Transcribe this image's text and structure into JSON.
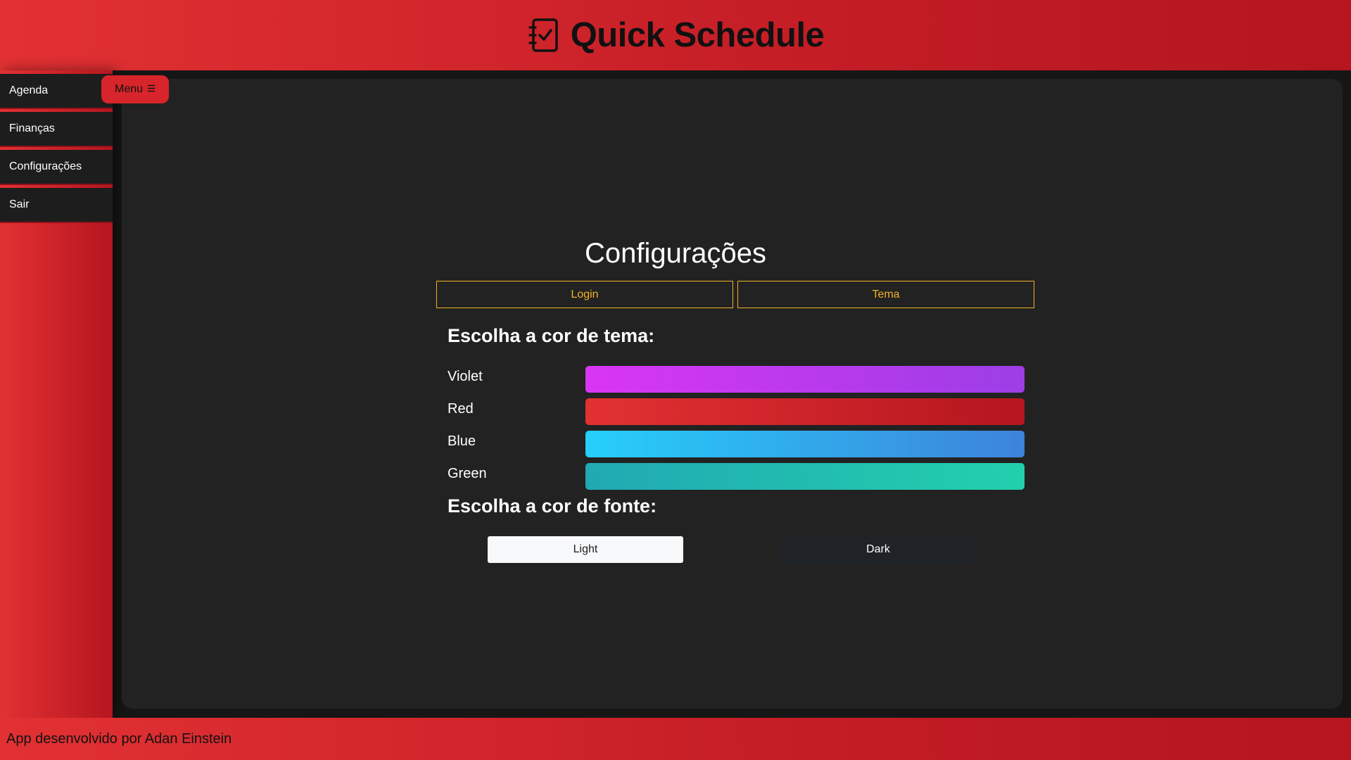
{
  "header": {
    "title": "Quick Schedule",
    "logo_icon": "checklist-notebook-icon"
  },
  "sidebar": {
    "items": [
      {
        "label": "Agenda"
      },
      {
        "label": "Finanças"
      },
      {
        "label": "Configurações"
      },
      {
        "label": "Sair"
      }
    ],
    "menu_button": {
      "label": "Menu",
      "icon": "hamburger-icon"
    }
  },
  "main": {
    "title": "Configurações",
    "tabs": [
      {
        "label": "Login"
      },
      {
        "label": "Tema"
      }
    ],
    "theme_section": {
      "heading": "Escolha a cor de tema:",
      "options": [
        {
          "label": "Violet",
          "gradient": [
            "#d936f3",
            "#9c3ee6"
          ]
        },
        {
          "label": "Red",
          "gradient": [
            "#e23133",
            "#b5161f"
          ]
        },
        {
          "label": "Blue",
          "gradient": [
            "#26cffb",
            "#3d83da"
          ]
        },
        {
          "label": "Green",
          "gradient": [
            "#21a9b3",
            "#22d0ad"
          ]
        }
      ]
    },
    "font_section": {
      "heading": "Escolha a cor de fonte:",
      "light_label": "Light",
      "dark_label": "Dark"
    }
  },
  "footer": {
    "text": "App desenvolvido por Adan Einstein"
  },
  "colors": {
    "accent": "#d7252b",
    "tab_border": "#f0b226",
    "content_bg": "#222222",
    "page_bg": "#161616"
  }
}
